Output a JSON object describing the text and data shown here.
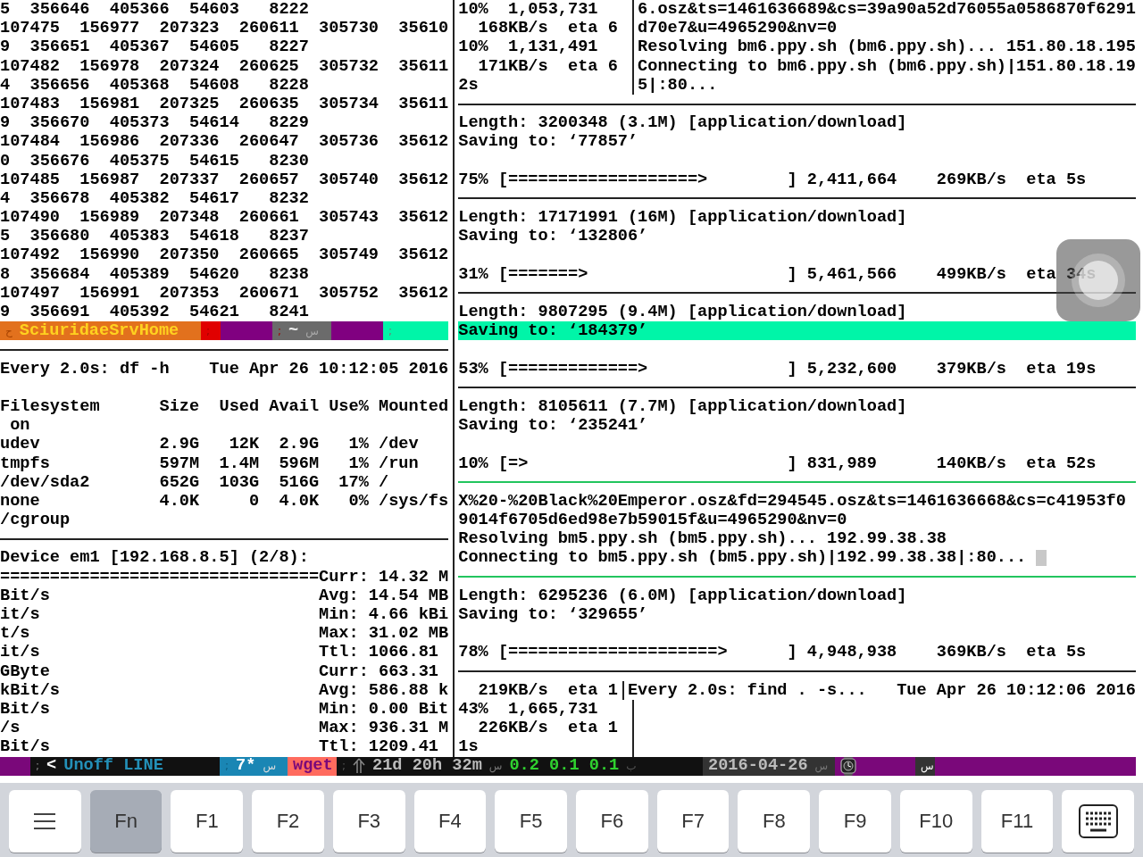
{
  "left_pane": {
    "rows": [
      {
        "kind": "text",
        "text": "5  356646  405366  54603   8222"
      },
      {
        "kind": "text",
        "text": "107475  156977  207323  260611  305730  35610"
      },
      {
        "kind": "text",
        "text": "9  356651  405367  54605   8227"
      },
      {
        "kind": "text",
        "text": "107482  156978  207324  260625  305732  35611"
      },
      {
        "kind": "text",
        "text": "4  356656  405368  54608   8228"
      },
      {
        "kind": "text",
        "text": "107483  156981  207325  260635  305734  35611"
      },
      {
        "kind": "text",
        "text": "9  356670  405373  54614   8229"
      },
      {
        "kind": "text",
        "text": "107484  156986  207336  260647  305736  35612"
      },
      {
        "kind": "text",
        "text": "0  356676  405375  54615   8230"
      },
      {
        "kind": "text",
        "text": "107485  156987  207337  260657  305740  35612"
      },
      {
        "kind": "text",
        "text": "4  356678  405382  54617   8232"
      },
      {
        "kind": "text",
        "text": "107490  156989  207348  260661  305743  35612"
      },
      {
        "kind": "text",
        "text": "5  356680  405383  54618   8237"
      },
      {
        "kind": "text",
        "text": "107492  156990  207350  260665  305749  35612"
      },
      {
        "kind": "text",
        "text": "8  356684  405389  54620   8238"
      },
      {
        "kind": "text",
        "text": "107497  156991  207353  260671  305752  35612"
      },
      {
        "kind": "text",
        "text": "9  356691  405392  54621   8241"
      },
      {
        "kind": "status",
        "segments": [
          {
            "color": "#e2711d",
            "parts": [
              {
                "kind": "glyph",
                "text": "ح"
              },
              {
                "kind": "label",
                "text": "SciuridaeSrvHome"
              }
            ]
          },
          {
            "color": "#e00000",
            "parts": [
              {
                "kind": "glyph",
                "text": ";"
              }
            ]
          },
          {
            "color": "#800080"
          },
          {
            "color": "#6b6b6b",
            "parts": [
              {
                "kind": "glyph",
                "text": ";"
              },
              {
                "kind": "label",
                "text": "~"
              },
              {
                "kind": "glyph",
                "text": "س"
              }
            ]
          },
          {
            "color": "#800080"
          },
          {
            "color": "#00f5a8",
            "parts": [
              {
                "kind": "glyph",
                "text": ";"
              }
            ]
          }
        ]
      },
      {
        "kind": "divider"
      },
      {
        "kind": "text",
        "text": "Every 2.0s: df -h    Tue Apr 26 10:12:05 2016"
      },
      {
        "kind": "blank"
      },
      {
        "kind": "text",
        "text": "Filesystem      Size  Used Avail Use% Mounted"
      },
      {
        "kind": "text",
        "text": " on"
      },
      {
        "kind": "text",
        "text": "udev            2.9G   12K  2.9G   1% /dev"
      },
      {
        "kind": "text",
        "text": "tmpfs           597M  1.4M  596M   1% /run"
      },
      {
        "kind": "text",
        "text": "/dev/sda2       652G  103G  516G  17% /"
      },
      {
        "kind": "text",
        "text": "none            4.0K     0  4.0K   0% /sys/fs"
      },
      {
        "kind": "text",
        "text": "/cgroup"
      },
      {
        "kind": "divider"
      },
      {
        "kind": "text",
        "text": "Device em1 [192.168.8.5] (2/8):"
      },
      {
        "kind": "text",
        "text": "================================Curr: 14.32 M"
      },
      {
        "kind": "pair",
        "left": "Bit/s",
        "right": "Avg: 14.54 MB"
      },
      {
        "kind": "pair",
        "left": "it/s",
        "right": "Min: 4.66 kBi"
      },
      {
        "kind": "pair",
        "left": "t/s",
        "right": "Max: 31.02 MB"
      },
      {
        "kind": "pair",
        "left": "it/s",
        "right": "Ttl: 1066.81"
      },
      {
        "kind": "pair",
        "left": "GByte",
        "right": "Curr: 663.31"
      },
      {
        "kind": "pair",
        "left": "kBit/s",
        "right": "Avg: 586.88 k"
      },
      {
        "kind": "pair",
        "left": "Bit/s",
        "right": "Min: 0.00 Bit"
      },
      {
        "kind": "pair",
        "left": "/s",
        "right": "Max: 936.31 M"
      },
      {
        "kind": "pair",
        "left": "Bit/s",
        "right": "Ttl: 1209.41"
      }
    ]
  },
  "right_pane": {
    "rows": [
      {
        "kind": "split",
        "left": "10%  1,053,731",
        "right": "6.osz&ts=1461636689&cs=39a90a52d76055a0586870f6291"
      },
      {
        "kind": "split",
        "left": "  168KB/s  eta 6",
        "right": "d70e7&u=4965290&nv=0"
      },
      {
        "kind": "split",
        "left": "10%  1,131,491",
        "right": "Resolving bm6.ppy.sh (bm6.ppy.sh)... 151.80.18.195"
      },
      {
        "kind": "split",
        "left": "  171KB/s  eta 6",
        "right": "Connecting to bm6.ppy.sh (bm6.ppy.sh)|151.80.18.19"
      },
      {
        "kind": "split",
        "left": "2s",
        "right": "5|:80..."
      },
      {
        "kind": "divider"
      },
      {
        "kind": "text",
        "text": "Length: 3200348 (3.1M) [application/download]"
      },
      {
        "kind": "text",
        "text": "Saving to: ‘77857’"
      },
      {
        "kind": "blank"
      },
      {
        "kind": "text",
        "text": "75% [===================>        ] 2,411,664    269KB/s  eta 5s"
      },
      {
        "kind": "divider"
      },
      {
        "kind": "text",
        "text": "Length: 17171991 (16M) [application/download]"
      },
      {
        "kind": "text",
        "text": "Saving to: ‘132806’"
      },
      {
        "kind": "blank"
      },
      {
        "kind": "text",
        "text": "31% [=======>                    ] 5,461,566    499KB/s  eta 34s"
      },
      {
        "kind": "divider"
      },
      {
        "kind": "text",
        "text": "Length: 9807295 (9.4M) [application/download]"
      },
      {
        "kind": "highlight",
        "text": "Saving to: ‘184379’"
      },
      {
        "kind": "blank"
      },
      {
        "kind": "text",
        "text": "53% [=============>              ] 5,232,600    379KB/s  eta 19s"
      },
      {
        "kind": "divider"
      },
      {
        "kind": "text",
        "text": "Length: 8105611 (7.7M) [application/download]"
      },
      {
        "kind": "text",
        "text": "Saving to: ‘235241’"
      },
      {
        "kind": "blank"
      },
      {
        "kind": "text",
        "text": "10% [=>                          ] 831,989      140KB/s  eta 52s"
      },
      {
        "kind": "active-divider"
      },
      {
        "kind": "text",
        "text": "X%20-%20Black%20Emperor.osz&fd=294545.osz&ts=1461636668&cs=c41953f0"
      },
      {
        "kind": "text",
        "text": "9014f6705d6ed98e7b59015f&u=4965290&nv=0"
      },
      {
        "kind": "text",
        "text": "Resolving bm5.ppy.sh (bm5.ppy.sh)... 192.99.38.38"
      },
      {
        "kind": "cursor",
        "text": "Connecting to bm5.ppy.sh (bm5.ppy.sh)|192.99.38.38|:80..."
      },
      {
        "kind": "active-divider"
      },
      {
        "kind": "text",
        "text": "Length: 6295236 (6.0M) [application/download]"
      },
      {
        "kind": "text",
        "text": "Saving to: ‘329655’"
      },
      {
        "kind": "blank"
      },
      {
        "kind": "text",
        "text": "78% [=====================>      ] 4,948,938    369KB/s  eta 5s"
      },
      {
        "kind": "divider"
      },
      {
        "kind": "split",
        "left": "  219KB/s  eta 1",
        "right": "Every 2.0s: find . -s...   Tue Apr 26 10:12:06 2016"
      },
      {
        "kind": "split",
        "left": "43%  1,665,731"
      },
      {
        "kind": "split",
        "left": "  226KB/s  eta 1"
      },
      {
        "kind": "split",
        "left": "1s"
      }
    ]
  },
  "status_bar": {
    "segments": [
      {
        "color": "#7a087a"
      },
      {
        "color": "#111111",
        "parts": [
          {
            "kind": "glyph",
            "text": ";"
          },
          {
            "kind": "label",
            "text": "<"
          },
          {
            "kind": "label",
            "text": "Unoff LINE"
          }
        ]
      },
      {
        "color": "#1a86b4",
        "parts": [
          {
            "kind": "glyph",
            "text": ";"
          },
          {
            "kind": "label",
            "text": "7*"
          },
          {
            "kind": "glyph",
            "text": "س"
          }
        ]
      },
      {
        "color": "#ff6b5e",
        "parts": [
          {
            "kind": "label",
            "text": "wget"
          }
        ]
      },
      {
        "color": "#111111",
        "parts": [
          {
            "kind": "glyph",
            "text": ";"
          },
          {
            "kind": "arrow"
          },
          {
            "kind": "label",
            "text": "21d 20h 32m"
          },
          {
            "kind": "glyph",
            "text": "س"
          },
          {
            "kind": "label",
            "text": "0.2 0.1 0.1"
          },
          {
            "kind": "glyph",
            "text": "ب"
          }
        ]
      },
      {
        "color": "#333333",
        "parts": [
          {
            "kind": "label",
            "text": "2016-04-26"
          },
          {
            "kind": "glyph",
            "text": "س"
          }
        ]
      },
      {
        "color": "#7a087a",
        "parts": [
          {
            "kind": "watch"
          }
        ]
      },
      {
        "color": "#333333",
        "parts": [
          {
            "kind": "glyph",
            "text": "س"
          }
        ]
      },
      {
        "color": "#7a087a"
      }
    ]
  },
  "keyboard_bar": {
    "keys": [
      {
        "kind": "menu",
        "selected": false
      },
      {
        "kind": "label",
        "label": "Fn",
        "selected": true
      },
      {
        "kind": "label",
        "label": "F1",
        "selected": false
      },
      {
        "kind": "label",
        "label": "F2",
        "selected": false
      },
      {
        "kind": "label",
        "label": "F3",
        "selected": false
      },
      {
        "kind": "label",
        "label": "F4",
        "selected": false
      },
      {
        "kind": "label",
        "label": "F5",
        "selected": false
      },
      {
        "kind": "label",
        "label": "F6",
        "selected": false
      },
      {
        "kind": "label",
        "label": "F7",
        "selected": false
      },
      {
        "kind": "label",
        "label": "F8",
        "selected": false
      },
      {
        "kind": "label",
        "label": "F9",
        "selected": false
      },
      {
        "kind": "label",
        "label": "F10",
        "selected": false
      },
      {
        "kind": "label",
        "label": "F11",
        "selected": false
      },
      {
        "kind": "keyboard",
        "selected": false
      }
    ]
  }
}
